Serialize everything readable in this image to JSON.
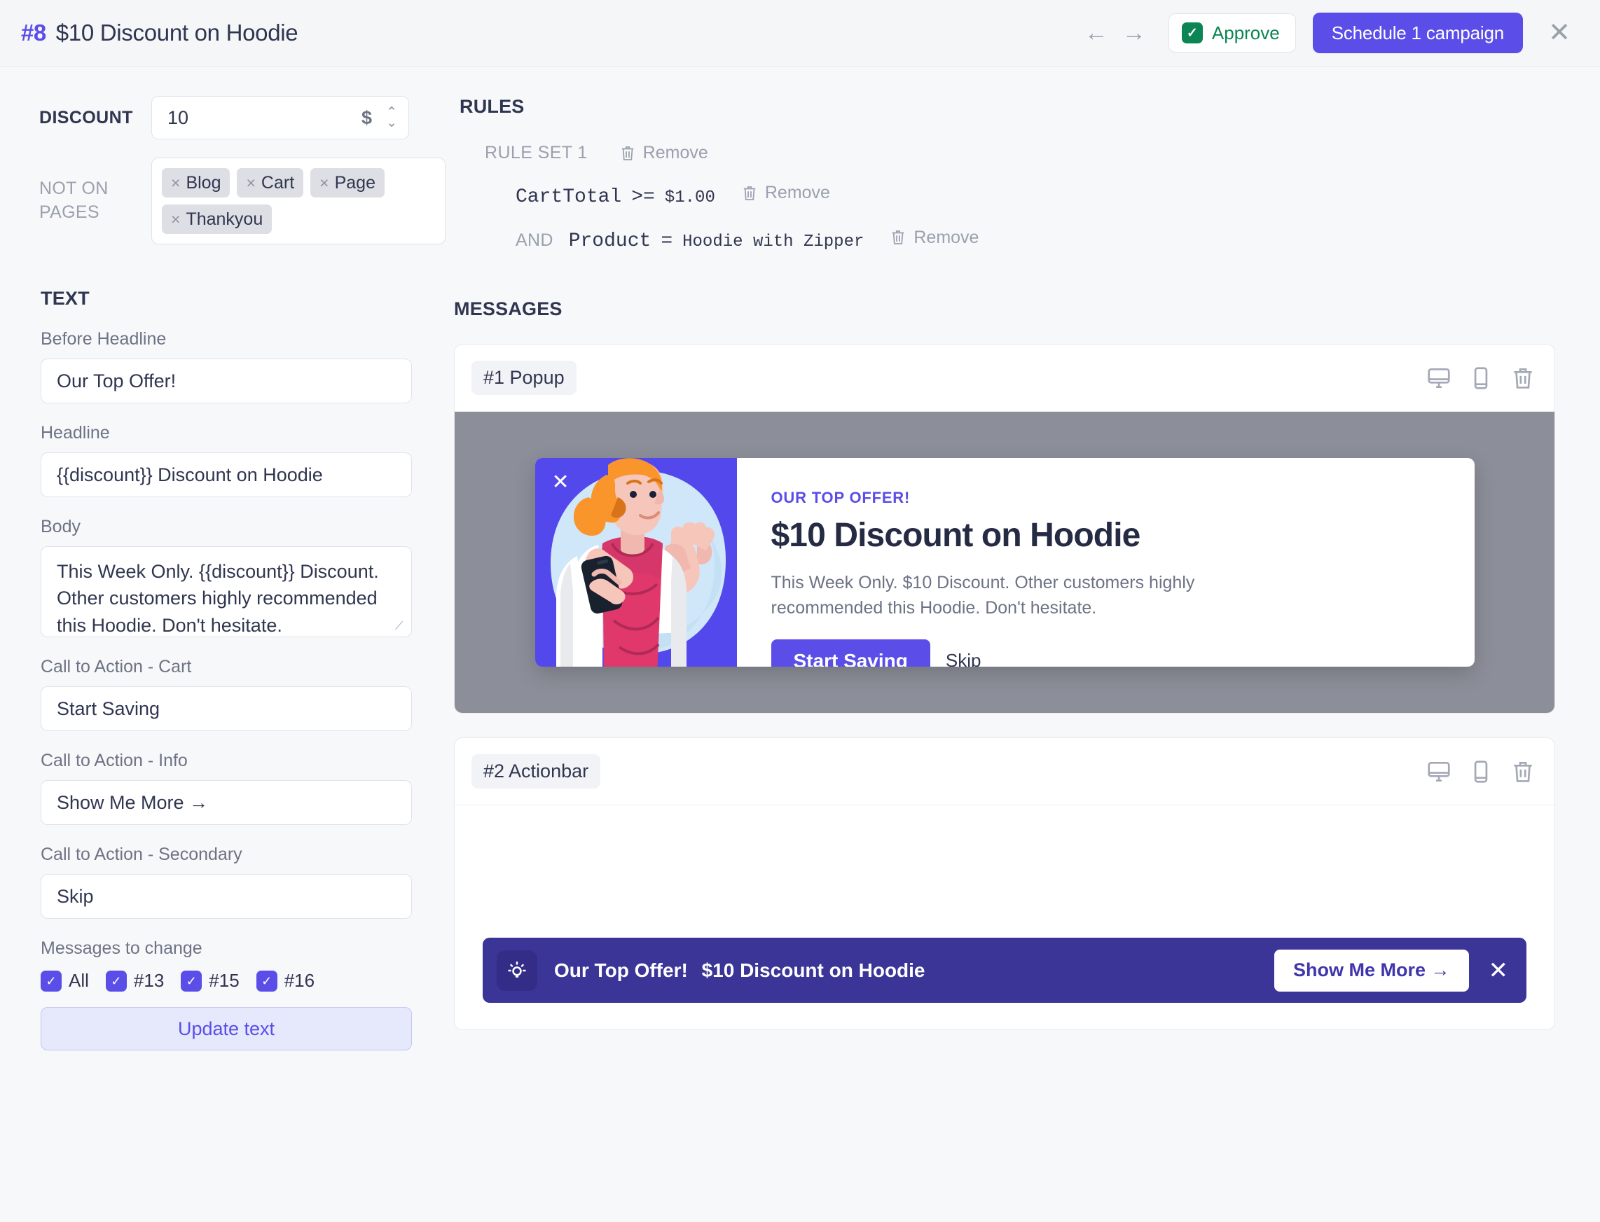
{
  "header": {
    "id": "#8",
    "title": "$10 Discount on Hoodie",
    "prev_label": "←",
    "next_label": "→",
    "approve_label": "Approve",
    "approve_color": "#0b8553",
    "schedule_label": "Schedule 1 campaign",
    "schedule_color": "#5b4ee8",
    "close_label": "✕"
  },
  "discount": {
    "label": "DISCOUNT",
    "value": "10",
    "currency": "$",
    "stepper_up": "⌃",
    "stepper_down": "⌄"
  },
  "not_on_pages": {
    "label": "NOT ON PAGES",
    "tags": [
      "Blog",
      "Cart",
      "Page",
      "Thankyou"
    ],
    "remove_glyph": "×"
  },
  "text_section": {
    "title": "TEXT",
    "fields": [
      {
        "label": "Before Headline",
        "value": "Our Top Offer!"
      },
      {
        "label": "Headline",
        "value": "{{discount}} Discount on Hoodie"
      },
      {
        "label": "Body",
        "value": "This Week Only. {{discount}} Discount. Other customers highly recommended this Hoodie. Don't hesitate."
      },
      {
        "label": "Call to Action - Cart",
        "value": "Start Saving"
      },
      {
        "label": "Call to Action - Info",
        "value": "Show Me More →"
      },
      {
        "label": "Call to Action - Secondary",
        "value": "Skip"
      }
    ],
    "messages_to_change_label": "Messages to change",
    "checkboxes": [
      {
        "label": "All",
        "checked": true
      },
      {
        "label": "#13",
        "checked": true
      },
      {
        "label": "#15",
        "checked": true
      },
      {
        "label": "#16",
        "checked": true
      }
    ],
    "checkbox_glyph": "✓",
    "update_button": "Update text"
  },
  "rules": {
    "title": "RULES",
    "set_label": "RULE SET 1",
    "set_remove_label": "Remove",
    "conditions": [
      {
        "conjunction": "",
        "field": "CartTotal",
        "operator": ">=",
        "value": "$1.00",
        "remove_label": "Remove"
      },
      {
        "conjunction": "AND",
        "field": "Product",
        "operator": "=",
        "value": "Hoodie with Zipper",
        "remove_label": "Remove"
      }
    ]
  },
  "messages": {
    "title": "MESSAGES",
    "cards": [
      {
        "chip": "#1 Popup",
        "type": "popup",
        "preview": {
          "pre_headline": "OUR TOP OFFER!",
          "headline": "$10 Discount on Hoodie",
          "body": "This Week Only. $10 Discount. Other customers highly recommended this Hoodie. Don't hesitate.",
          "cta_primary": "Start Saving",
          "cta_secondary": "Skip",
          "close_glyph": "✕",
          "accent_color": "#5b4ee8",
          "art_bg_color": "#5348ec",
          "backdrop_color": "#8c8f99"
        }
      },
      {
        "chip": "#2 Actionbar",
        "type": "actionbar",
        "preview": {
          "pre_headline": "Our Top Offer!",
          "headline": "$10 Discount on Hoodie",
          "cta": "Show Me More →",
          "close_glyph": "✕",
          "bar_color": "#3b3597"
        }
      }
    ]
  }
}
